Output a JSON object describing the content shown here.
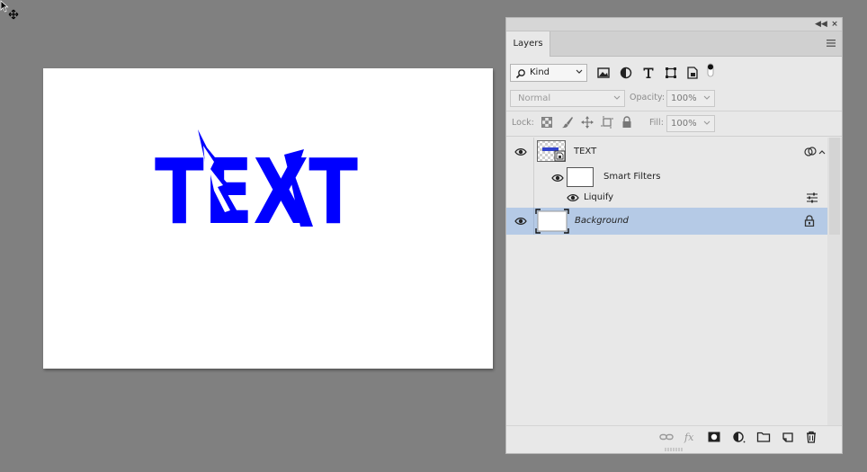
{
  "canvas": {
    "text": "TEXT",
    "text_color": "#0000ff",
    "background": "#ffffff"
  },
  "panel": {
    "tab_label": "Layers",
    "collapse_icon": "double-chevron-left-icon",
    "close_icon": "close-icon",
    "menu_icon": "hamburger-menu-icon",
    "filter": {
      "kind_label": "Kind",
      "icons": [
        "pixel-filter-icon",
        "adjustment-filter-icon",
        "type-filter-icon",
        "shape-filter-icon",
        "smart-object-filter-icon"
      ]
    },
    "blend_mode": "Normal",
    "opacity_label": "Opacity:",
    "opacity_value": "100%",
    "lock_label": "Lock:",
    "fill_label": "Fill:",
    "fill_value": "100%",
    "layers": {
      "text_layer": {
        "name": "TEXT"
      },
      "smart_filters": {
        "name": "Smart Filters"
      },
      "liquify": {
        "name": "Liquify"
      },
      "background": {
        "name": "Background"
      }
    },
    "selection_color": "#b5cae6"
  }
}
